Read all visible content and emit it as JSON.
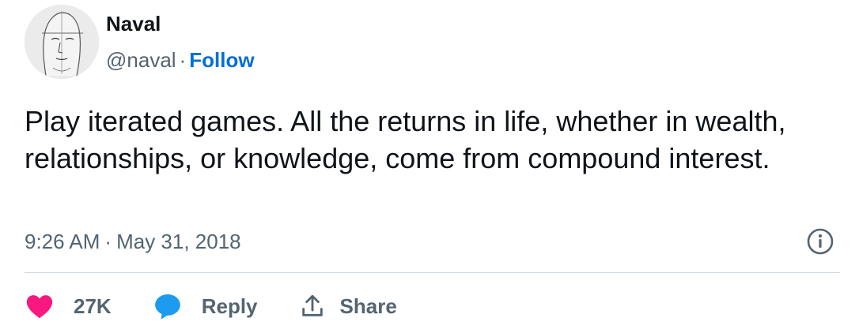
{
  "author": {
    "name": "Naval",
    "handle": "@naval",
    "separator": "·",
    "follow_label": "Follow"
  },
  "tweet": {
    "text": "Play iterated games. All the returns in life, whether in wealth, relationships, or knowledge, come from compound interest.",
    "time": "9:26 AM",
    "date": "May 31, 2018"
  },
  "actions": {
    "like_count": "27K",
    "reply_label": "Reply",
    "share_label": "Share"
  },
  "icons": {
    "like": "heart-icon",
    "reply": "speech-bubble-icon",
    "share": "share-upload-icon",
    "info": "info-icon"
  },
  "colors": {
    "like": "#f91880",
    "reply": "#1d9bf0",
    "follow": "#006fd6",
    "secondary_text": "#536471",
    "divider": "#cfd9de"
  }
}
